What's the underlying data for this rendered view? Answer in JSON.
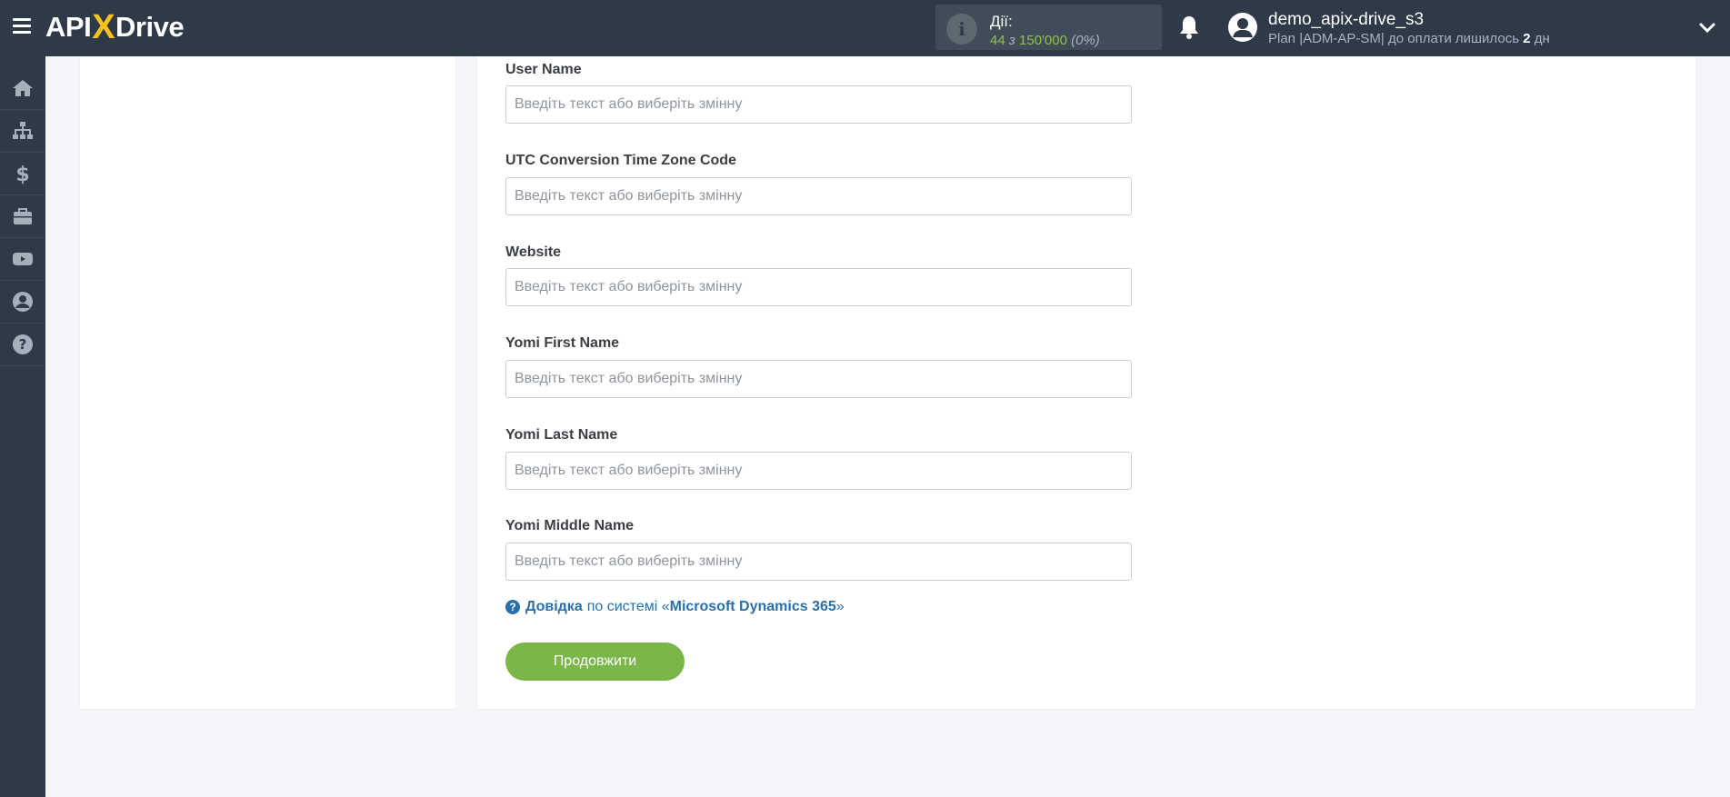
{
  "header": {
    "logo_left": "API",
    "logo_x": "X",
    "logo_right": "Drive",
    "actions_label": "Дії:",
    "actions_used": "44",
    "actions_of": "з",
    "actions_total": "150'000",
    "actions_percent": "(0%)",
    "user_name": "demo_apix-drive_s3",
    "plan_text": "Plan |ADM-AP-SM| до оплати лишилось",
    "plan_days": "2",
    "plan_days_unit": "дн"
  },
  "sidebar": {
    "items": [
      {
        "icon": "home-icon"
      },
      {
        "icon": "sitemap-icon"
      },
      {
        "icon": "dollar-icon"
      },
      {
        "icon": "briefcase-icon"
      },
      {
        "icon": "youtube-icon"
      },
      {
        "icon": "user-circle-icon"
      },
      {
        "icon": "question-circle-icon"
      }
    ]
  },
  "form": {
    "placeholder": "Введіть текст або виберіть змінну",
    "fields": [
      {
        "label": "User Name"
      },
      {
        "label": "UTC Conversion Time Zone Code"
      },
      {
        "label": "Website"
      },
      {
        "label": "Yomi First Name"
      },
      {
        "label": "Yomi Last Name"
      },
      {
        "label": "Yomi Middle Name"
      }
    ],
    "help_prefix": "Довідка",
    "help_middle": "по системі «",
    "help_system": "Microsoft Dynamics 365",
    "help_suffix": "»",
    "continue_label": "Продовжити"
  },
  "colors": {
    "topbar": "#2f3a48",
    "accent_green": "#7ab648",
    "link_blue": "#2a6fa8",
    "logo_yellow": "#f7c21d"
  }
}
